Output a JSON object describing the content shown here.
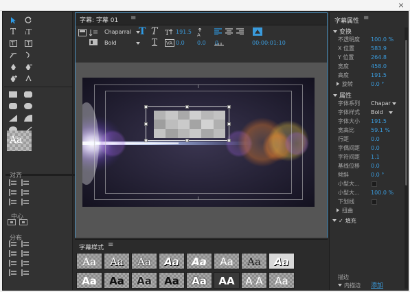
{
  "window": {
    "close_glyph": "×"
  },
  "left_panel": {
    "style_preview": "Aa",
    "align_label": "对齐",
    "center_label": "中心",
    "distribute_label": "分布"
  },
  "editor": {
    "tab_title": "字幕: 字幕 01",
    "tab_menu": "≡",
    "toolbar": {
      "font_family": "Chaparral",
      "font_style": "Bold",
      "font_size": "191.5",
      "kerning": "0.0",
      "leading": "0.0",
      "tab_stops_value": "0",
      "timecode": "00:00:01:10"
    }
  },
  "styles_panel": {
    "tab_title": "字幕样式",
    "tab_menu": "≡",
    "row1": [
      "Aa",
      "Aa",
      "Aa",
      "Aa",
      "Aa",
      "Aa",
      "Aa",
      "Aa"
    ],
    "row2": [
      "Aa",
      "Aa",
      "Aa",
      "Aa",
      "Aa",
      "AA",
      "A A",
      "Aa"
    ]
  },
  "properties": {
    "panel_title": "字幕属性",
    "panel_menu": "≡",
    "transform_group": "变换",
    "transform_rows": [
      {
        "label": "不透明度",
        "value": "100.0 %"
      },
      {
        "label": "X 位置",
        "value": "583.9"
      },
      {
        "label": "Y 位置",
        "value": "264.8"
      },
      {
        "label": "宽度",
        "value": "458.0"
      },
      {
        "label": "高度",
        "value": "191.5"
      }
    ],
    "rotation": {
      "label": "旋转",
      "value": "0.0 °"
    },
    "props_group": "属性",
    "font_family": {
      "label": "字体系列",
      "value": "Chapar"
    },
    "font_style": {
      "label": "字体样式",
      "value": "Bold"
    },
    "props_rows": [
      {
        "label": "字体大小",
        "value": "191.5"
      },
      {
        "label": "宽高比",
        "value": "59.1 %"
      },
      {
        "label": "行距",
        "value": "0.0"
      },
      {
        "label": "字偶间距",
        "value": "0.0"
      },
      {
        "label": "字符间距",
        "value": "1.1"
      },
      {
        "label": "基线位移",
        "value": "0.0"
      },
      {
        "label": "倾斜",
        "value": "0.0 °"
      }
    ],
    "small_caps": {
      "label": "小型大...",
      "value": ""
    },
    "small_caps_size": {
      "label": "小型大...",
      "value": "100.0 %"
    },
    "underline": {
      "label": "下划线"
    },
    "distort": {
      "label": "扭曲"
    },
    "fill": {
      "label": "填充",
      "checked_glyph": "✓"
    },
    "stroke": {
      "label": "描边"
    },
    "inner_stroke": {
      "label": "内描边",
      "action": "添加"
    }
  },
  "colors": {
    "accent_blue": "#3a9bdc",
    "panel_bg": "#2e2e2e",
    "canvas_bg": "#555555"
  }
}
